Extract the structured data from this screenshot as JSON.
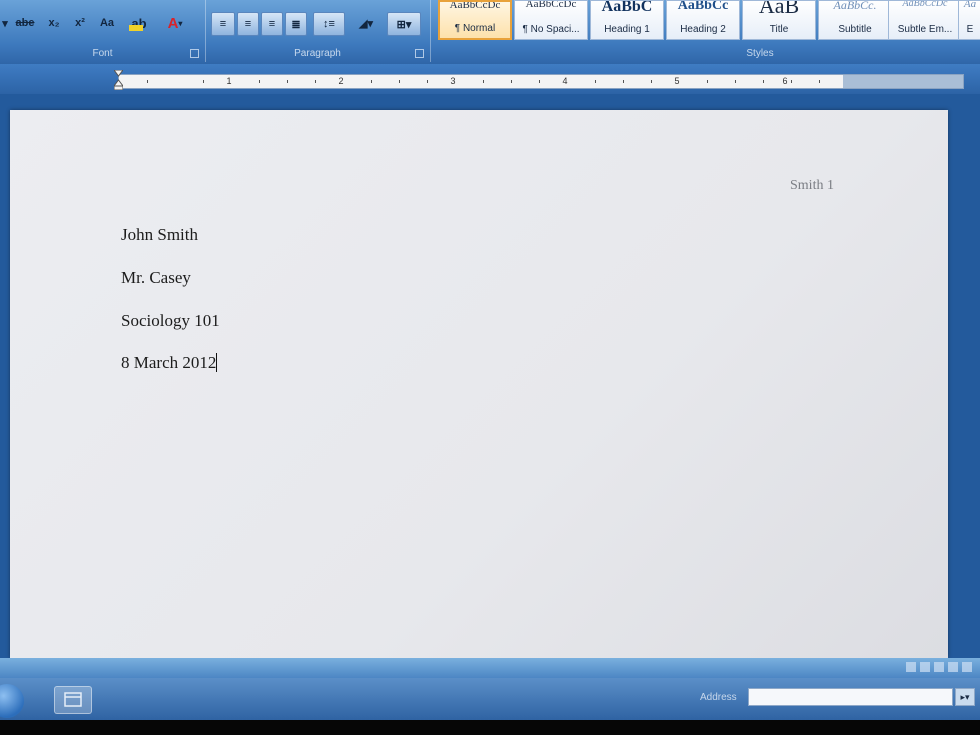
{
  "ribbon": {
    "font_group_label": "Font",
    "paragraph_group_label": "Paragraph",
    "styles_group_label": "Styles",
    "font_buttons": [
      "abe",
      "x₂",
      "x²",
      "Aa"
    ],
    "styles": [
      {
        "sample": "AaBbCcDc",
        "name": "¶ Normal",
        "active": true
      },
      {
        "sample": "AaBbCcDc",
        "name": "¶ No Spaci...",
        "active": false
      },
      {
        "sample": "AaBbC",
        "name": "Heading 1",
        "active": false
      },
      {
        "sample": "AaBbCc",
        "name": "Heading 2",
        "active": false
      },
      {
        "sample": "AaB",
        "name": "Title",
        "active": false
      },
      {
        "sample": "AaBbCc.",
        "name": "Subtitle",
        "active": false
      },
      {
        "sample": "AaBbCcDc",
        "name": "Subtle Em...",
        "active": false
      },
      {
        "sample": "Aa",
        "name": "E",
        "active": false
      }
    ]
  },
  "ruler": {
    "numbers": [
      "1",
      "1",
      "2",
      "3",
      "4",
      "5",
      "6"
    ]
  },
  "document": {
    "header": "Smith 1",
    "lines": [
      "John Smith",
      "Mr. Casey",
      "Sociology 101",
      "8 March 2012"
    ]
  },
  "taskbar": {
    "address_label": "Address",
    "address_value": ""
  },
  "colors": {
    "ribbon": "#3d79bd",
    "page": "#e8e9ed",
    "active_style_border": "#e8a23b"
  }
}
